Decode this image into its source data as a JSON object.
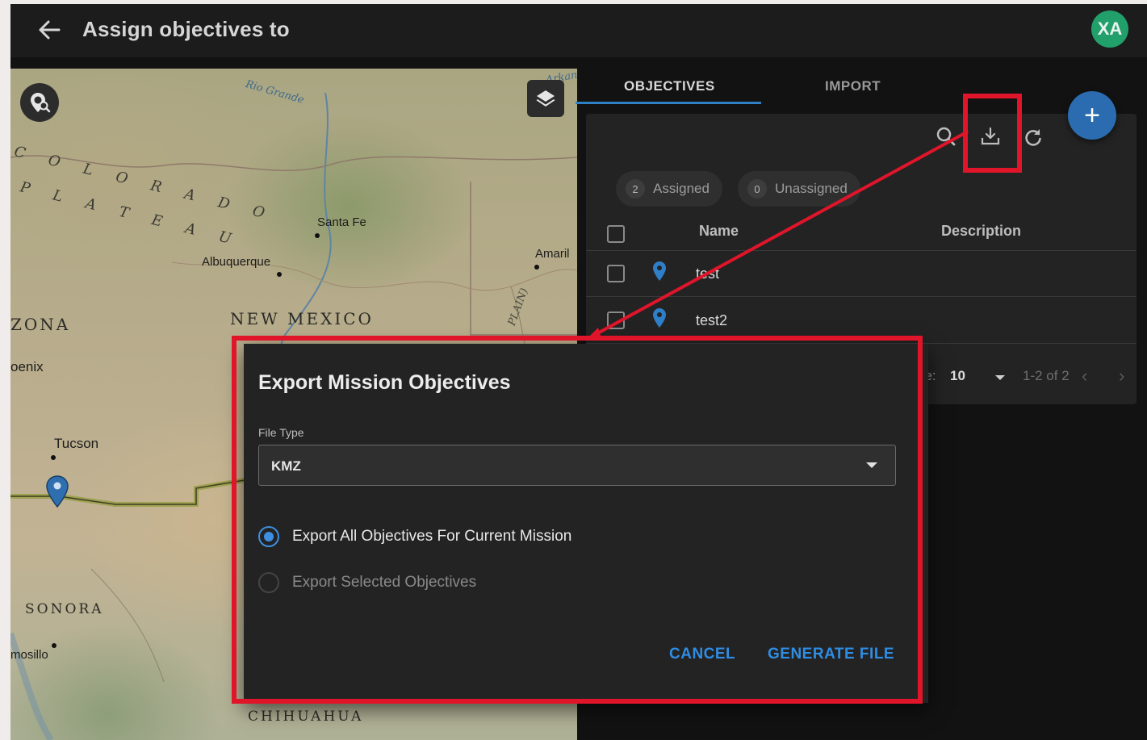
{
  "header": {
    "title": "Assign objectives to",
    "avatar_initials": "XA"
  },
  "map": {
    "labels": {
      "colorado_plateau_line1": "C O L O R A D O",
      "colorado_plateau_line2": "P L A T E A U",
      "rio_grande": "Rio Grande",
      "santa_fe": "Santa Fe",
      "albuquerque": "Albuquerque",
      "amarillo": "Amaril",
      "new_mexico": "NEW MEXICO",
      "arizona": "ZONA",
      "phoenix": "oenix",
      "tucson": "Tucson",
      "sonora": "SONORA",
      "hermosillo": "mosillo",
      "chihuahua": "CHIHUAHUA",
      "plain": "PLAIN)",
      "arkan": "Arkan"
    }
  },
  "tabs": [
    {
      "label": "OBJECTIVES"
    },
    {
      "label": "IMPORT"
    }
  ],
  "chips": {
    "assigned": {
      "count": "2",
      "label": "Assigned"
    },
    "unassigned": {
      "count": "0",
      "label": "Unassigned"
    }
  },
  "table": {
    "columns": [
      "Name",
      "Description"
    ],
    "rows": [
      {
        "name": "test",
        "description": ""
      },
      {
        "name": "test2",
        "description": ""
      }
    ]
  },
  "pagination": {
    "rows_per_page_label": "ge:",
    "rows_per_page": "10",
    "range": "1-2 of 2"
  },
  "dialog": {
    "title": "Export Mission Objectives",
    "file_type_label": "File Type",
    "file_type_value": "KMZ",
    "options": [
      {
        "label": "Export All Objectives For Current Mission",
        "selected": true
      },
      {
        "label": "Export Selected Objectives",
        "selected": false
      }
    ],
    "cancel_label": "CANCEL",
    "generate_label": "GENERATE FILE"
  },
  "colors": {
    "accent": "#2f8de4",
    "annotation": "#e0152a",
    "avatar": "#22a06b",
    "fab": "#2b6cb0"
  }
}
